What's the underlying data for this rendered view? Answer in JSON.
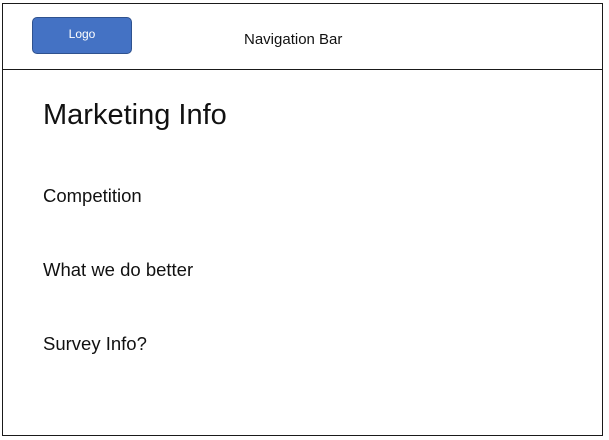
{
  "navbar": {
    "logo_label": "Logo",
    "title": "Navigation Bar"
  },
  "main": {
    "title": "Marketing Info",
    "sections": [
      {
        "label": "Competition"
      },
      {
        "label": "What we do better"
      },
      {
        "label": "Survey Info?"
      }
    ]
  },
  "colors": {
    "logo_fill": "#4472c4",
    "logo_border": "#2f528f",
    "border": "#1a1a1a"
  }
}
